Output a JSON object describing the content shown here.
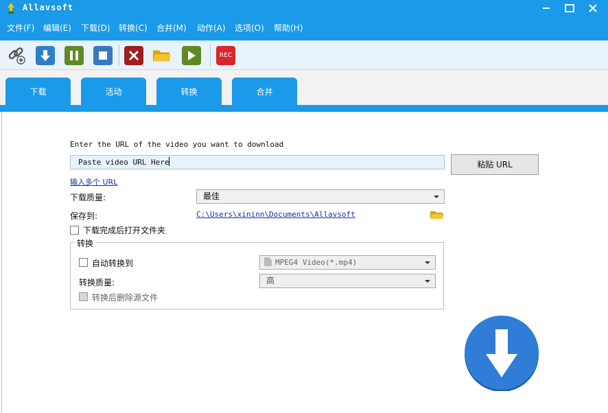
{
  "window": {
    "title": "Allavsoft",
    "accent_color": "#1a9ae8"
  },
  "menu": {
    "items": [
      "文件(F)",
      "编辑(E)",
      "下载(D)",
      "转换(C)",
      "合并(M)",
      "动作(A)",
      "选项(O)",
      "帮助(H)"
    ]
  },
  "toolbar": {
    "buttons": [
      "add-link-icon",
      "download-icon",
      "pause-icon",
      "stop-icon",
      "delete-icon",
      "open-folder-icon",
      "play-icon",
      "record-icon"
    ],
    "rec_label": "REC"
  },
  "tabs": [
    {
      "label": "下载",
      "active": true
    },
    {
      "label": "活动",
      "active": false
    },
    {
      "label": "转换",
      "active": false
    },
    {
      "label": "合并",
      "active": false
    }
  ],
  "download": {
    "prompt": "Enter the URL of the video you want to download",
    "url_value": "Paste video URL Here",
    "paste_button": "粘贴 URL",
    "multi_url_link": "输入多个 URL",
    "quality_label": "下载质量:",
    "quality_value": "最佳",
    "save_to_label": "保存到:",
    "save_path": "C:\\Users\\xininn\\Documents\\Allavsoft",
    "open_folder_checkbox": "下载完成后打开文件夹",
    "open_folder_checked": false
  },
  "convert_group": {
    "title": "转换",
    "auto_convert_label": "自动转换到",
    "auto_convert_checked": false,
    "format_value": "MPEG4 Video(*.mp4)",
    "quality_label": "转换质量:",
    "quality_value": "高",
    "delete_source_label": "转换后删除源文件",
    "delete_source_checked": false
  }
}
